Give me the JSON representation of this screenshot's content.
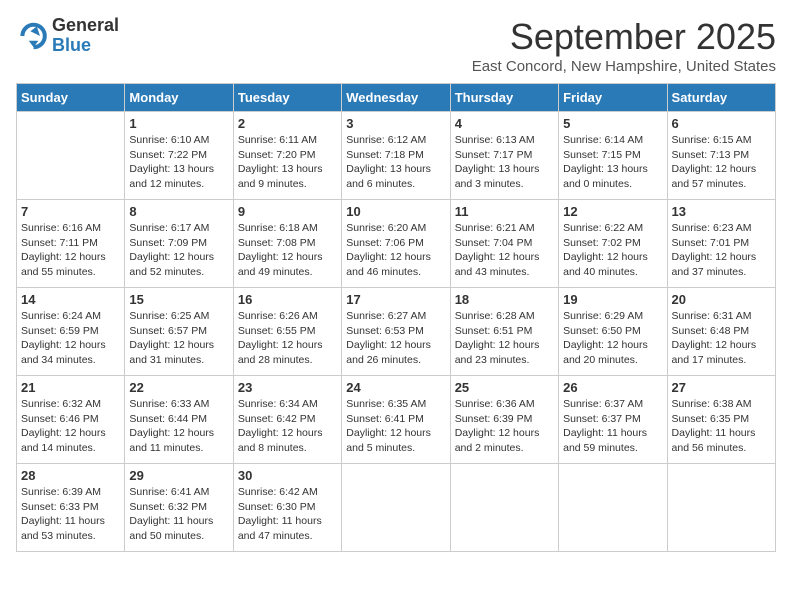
{
  "header": {
    "logo_general": "General",
    "logo_blue": "Blue",
    "title": "September 2025",
    "location": "East Concord, New Hampshire, United States"
  },
  "weekdays": [
    "Sunday",
    "Monday",
    "Tuesday",
    "Wednesday",
    "Thursday",
    "Friday",
    "Saturday"
  ],
  "weeks": [
    [
      {
        "day": "",
        "info": ""
      },
      {
        "day": "1",
        "info": "Sunrise: 6:10 AM\nSunset: 7:22 PM\nDaylight: 13 hours\nand 12 minutes."
      },
      {
        "day": "2",
        "info": "Sunrise: 6:11 AM\nSunset: 7:20 PM\nDaylight: 13 hours\nand 9 minutes."
      },
      {
        "day": "3",
        "info": "Sunrise: 6:12 AM\nSunset: 7:18 PM\nDaylight: 13 hours\nand 6 minutes."
      },
      {
        "day": "4",
        "info": "Sunrise: 6:13 AM\nSunset: 7:17 PM\nDaylight: 13 hours\nand 3 minutes."
      },
      {
        "day": "5",
        "info": "Sunrise: 6:14 AM\nSunset: 7:15 PM\nDaylight: 13 hours\nand 0 minutes."
      },
      {
        "day": "6",
        "info": "Sunrise: 6:15 AM\nSunset: 7:13 PM\nDaylight: 12 hours\nand 57 minutes."
      }
    ],
    [
      {
        "day": "7",
        "info": "Sunrise: 6:16 AM\nSunset: 7:11 PM\nDaylight: 12 hours\nand 55 minutes."
      },
      {
        "day": "8",
        "info": "Sunrise: 6:17 AM\nSunset: 7:09 PM\nDaylight: 12 hours\nand 52 minutes."
      },
      {
        "day": "9",
        "info": "Sunrise: 6:18 AM\nSunset: 7:08 PM\nDaylight: 12 hours\nand 49 minutes."
      },
      {
        "day": "10",
        "info": "Sunrise: 6:20 AM\nSunset: 7:06 PM\nDaylight: 12 hours\nand 46 minutes."
      },
      {
        "day": "11",
        "info": "Sunrise: 6:21 AM\nSunset: 7:04 PM\nDaylight: 12 hours\nand 43 minutes."
      },
      {
        "day": "12",
        "info": "Sunrise: 6:22 AM\nSunset: 7:02 PM\nDaylight: 12 hours\nand 40 minutes."
      },
      {
        "day": "13",
        "info": "Sunrise: 6:23 AM\nSunset: 7:01 PM\nDaylight: 12 hours\nand 37 minutes."
      }
    ],
    [
      {
        "day": "14",
        "info": "Sunrise: 6:24 AM\nSunset: 6:59 PM\nDaylight: 12 hours\nand 34 minutes."
      },
      {
        "day": "15",
        "info": "Sunrise: 6:25 AM\nSunset: 6:57 PM\nDaylight: 12 hours\nand 31 minutes."
      },
      {
        "day": "16",
        "info": "Sunrise: 6:26 AM\nSunset: 6:55 PM\nDaylight: 12 hours\nand 28 minutes."
      },
      {
        "day": "17",
        "info": "Sunrise: 6:27 AM\nSunset: 6:53 PM\nDaylight: 12 hours\nand 26 minutes."
      },
      {
        "day": "18",
        "info": "Sunrise: 6:28 AM\nSunset: 6:51 PM\nDaylight: 12 hours\nand 23 minutes."
      },
      {
        "day": "19",
        "info": "Sunrise: 6:29 AM\nSunset: 6:50 PM\nDaylight: 12 hours\nand 20 minutes."
      },
      {
        "day": "20",
        "info": "Sunrise: 6:31 AM\nSunset: 6:48 PM\nDaylight: 12 hours\nand 17 minutes."
      }
    ],
    [
      {
        "day": "21",
        "info": "Sunrise: 6:32 AM\nSunset: 6:46 PM\nDaylight: 12 hours\nand 14 minutes."
      },
      {
        "day": "22",
        "info": "Sunrise: 6:33 AM\nSunset: 6:44 PM\nDaylight: 12 hours\nand 11 minutes."
      },
      {
        "day": "23",
        "info": "Sunrise: 6:34 AM\nSunset: 6:42 PM\nDaylight: 12 hours\nand 8 minutes."
      },
      {
        "day": "24",
        "info": "Sunrise: 6:35 AM\nSunset: 6:41 PM\nDaylight: 12 hours\nand 5 minutes."
      },
      {
        "day": "25",
        "info": "Sunrise: 6:36 AM\nSunset: 6:39 PM\nDaylight: 12 hours\nand 2 minutes."
      },
      {
        "day": "26",
        "info": "Sunrise: 6:37 AM\nSunset: 6:37 PM\nDaylight: 11 hours\nand 59 minutes."
      },
      {
        "day": "27",
        "info": "Sunrise: 6:38 AM\nSunset: 6:35 PM\nDaylight: 11 hours\nand 56 minutes."
      }
    ],
    [
      {
        "day": "28",
        "info": "Sunrise: 6:39 AM\nSunset: 6:33 PM\nDaylight: 11 hours\nand 53 minutes."
      },
      {
        "day": "29",
        "info": "Sunrise: 6:41 AM\nSunset: 6:32 PM\nDaylight: 11 hours\nand 50 minutes."
      },
      {
        "day": "30",
        "info": "Sunrise: 6:42 AM\nSunset: 6:30 PM\nDaylight: 11 hours\nand 47 minutes."
      },
      {
        "day": "",
        "info": ""
      },
      {
        "day": "",
        "info": ""
      },
      {
        "day": "",
        "info": ""
      },
      {
        "day": "",
        "info": ""
      }
    ]
  ]
}
